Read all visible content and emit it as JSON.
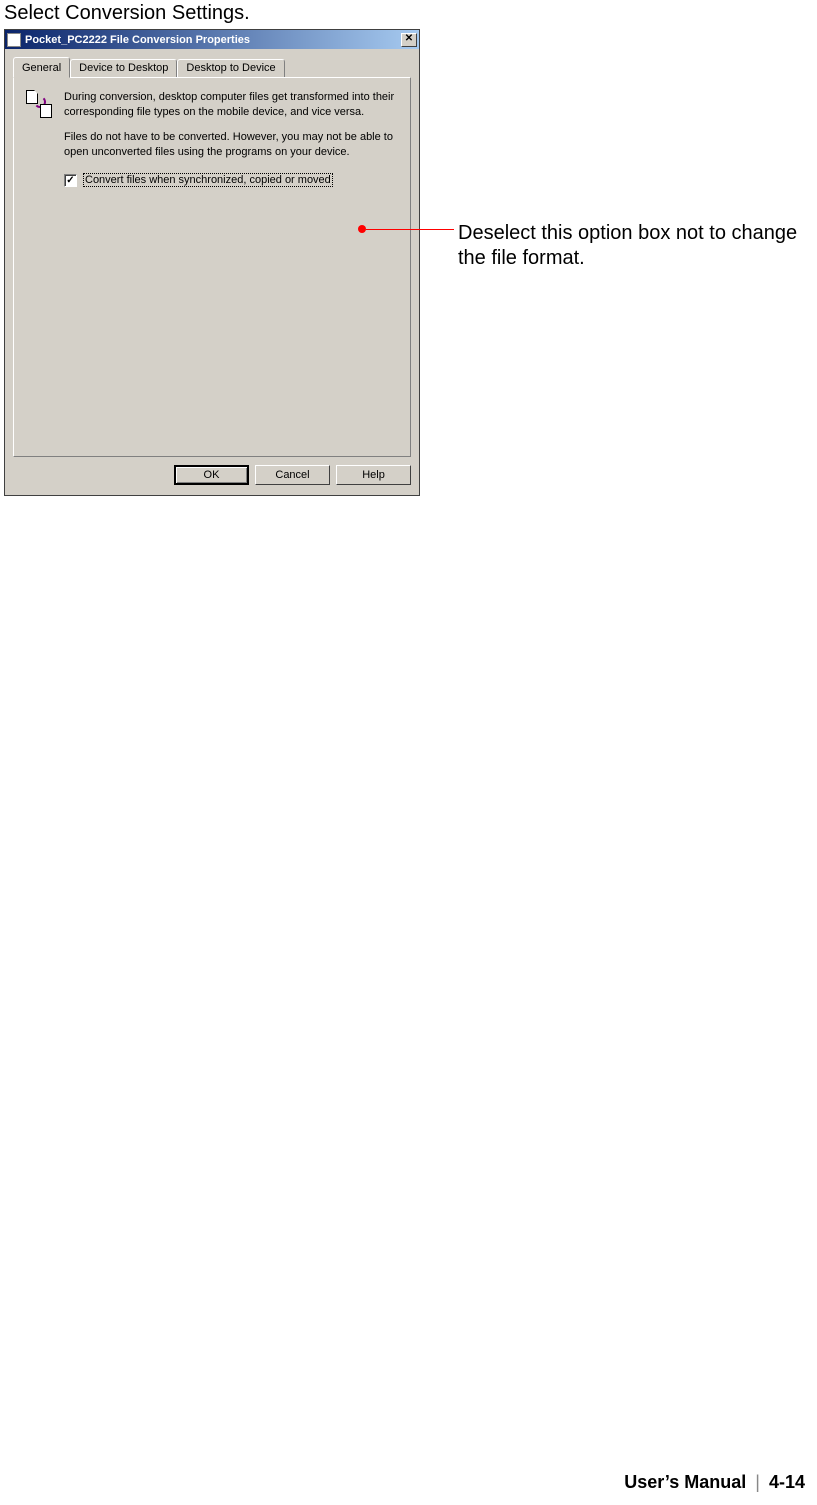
{
  "heading": "Select Conversion Settings.",
  "dialog": {
    "title": "Pocket_PC2222 File Conversion Properties",
    "tabs": [
      "General",
      "Device to Desktop",
      "Desktop to Device"
    ],
    "description1": "During conversion, desktop computer files get transformed into their corresponding file types on the mobile device, and vice versa.",
    "description2": "Files do not have to be converted. However, you may not be able to open unconverted files using the programs on your device.",
    "checkbox_label": "Convert files when synchronized, copied or moved",
    "buttons": {
      "ok": "OK",
      "cancel": "Cancel",
      "help": "Help"
    }
  },
  "callout": "Deselect this option box not to change the file format.",
  "footer": {
    "label": "User’s Manual",
    "page": "4-14"
  }
}
